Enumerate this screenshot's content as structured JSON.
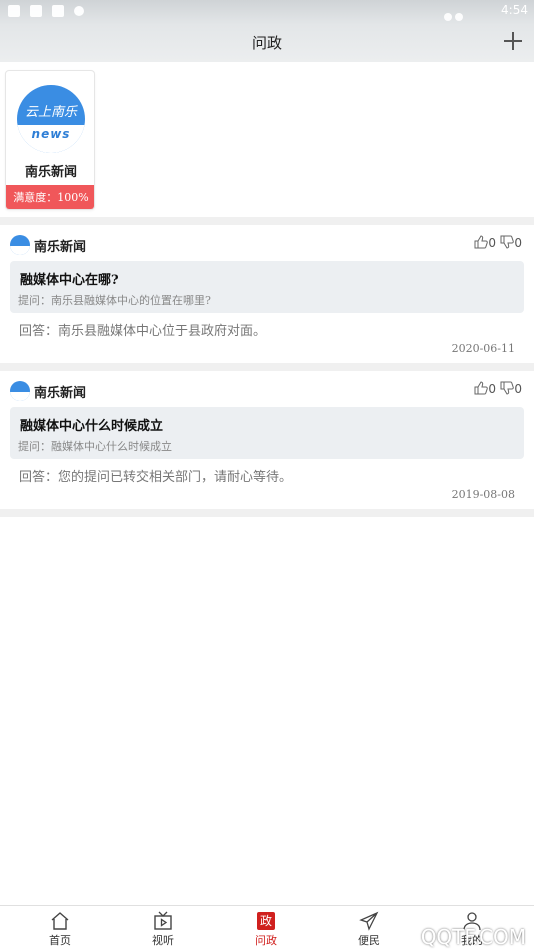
{
  "status_bar": {
    "time": "4:54"
  },
  "header": {
    "title": "问政"
  },
  "profile": {
    "logo_top_text": "云上南乐",
    "logo_band_text": "news",
    "name": "南乐新闻",
    "satisfaction": "满意度：100%"
  },
  "questions": [
    {
      "author": "南乐新闻",
      "likes": "0",
      "dislikes": "0",
      "title": "融媒体中心在哪?",
      "ask": "提问：南乐县融媒体中心的位置在哪里?",
      "answer": "回答：南乐县融媒体中心位于县政府对面。",
      "date": "2020-06-11"
    },
    {
      "author": "南乐新闻",
      "likes": "0",
      "dislikes": "0",
      "title": "融媒体中心什么时候成立",
      "ask": "提问：融媒体中心什么时候成立",
      "answer": "回答：您的提问已转交相关部门，请耐心等待。",
      "date": "2019-08-08"
    }
  ],
  "nav": {
    "items": [
      {
        "label": "首页",
        "icon": "home-icon"
      },
      {
        "label": "视听",
        "icon": "tv-icon"
      },
      {
        "label": "问政",
        "icon": "zheng-icon",
        "badge": "政"
      },
      {
        "label": "便民",
        "icon": "send-icon"
      },
      {
        "label": "我的",
        "icon": "user-icon"
      }
    ],
    "active_color": "#d0201e"
  },
  "watermark": "QQTF.COM"
}
